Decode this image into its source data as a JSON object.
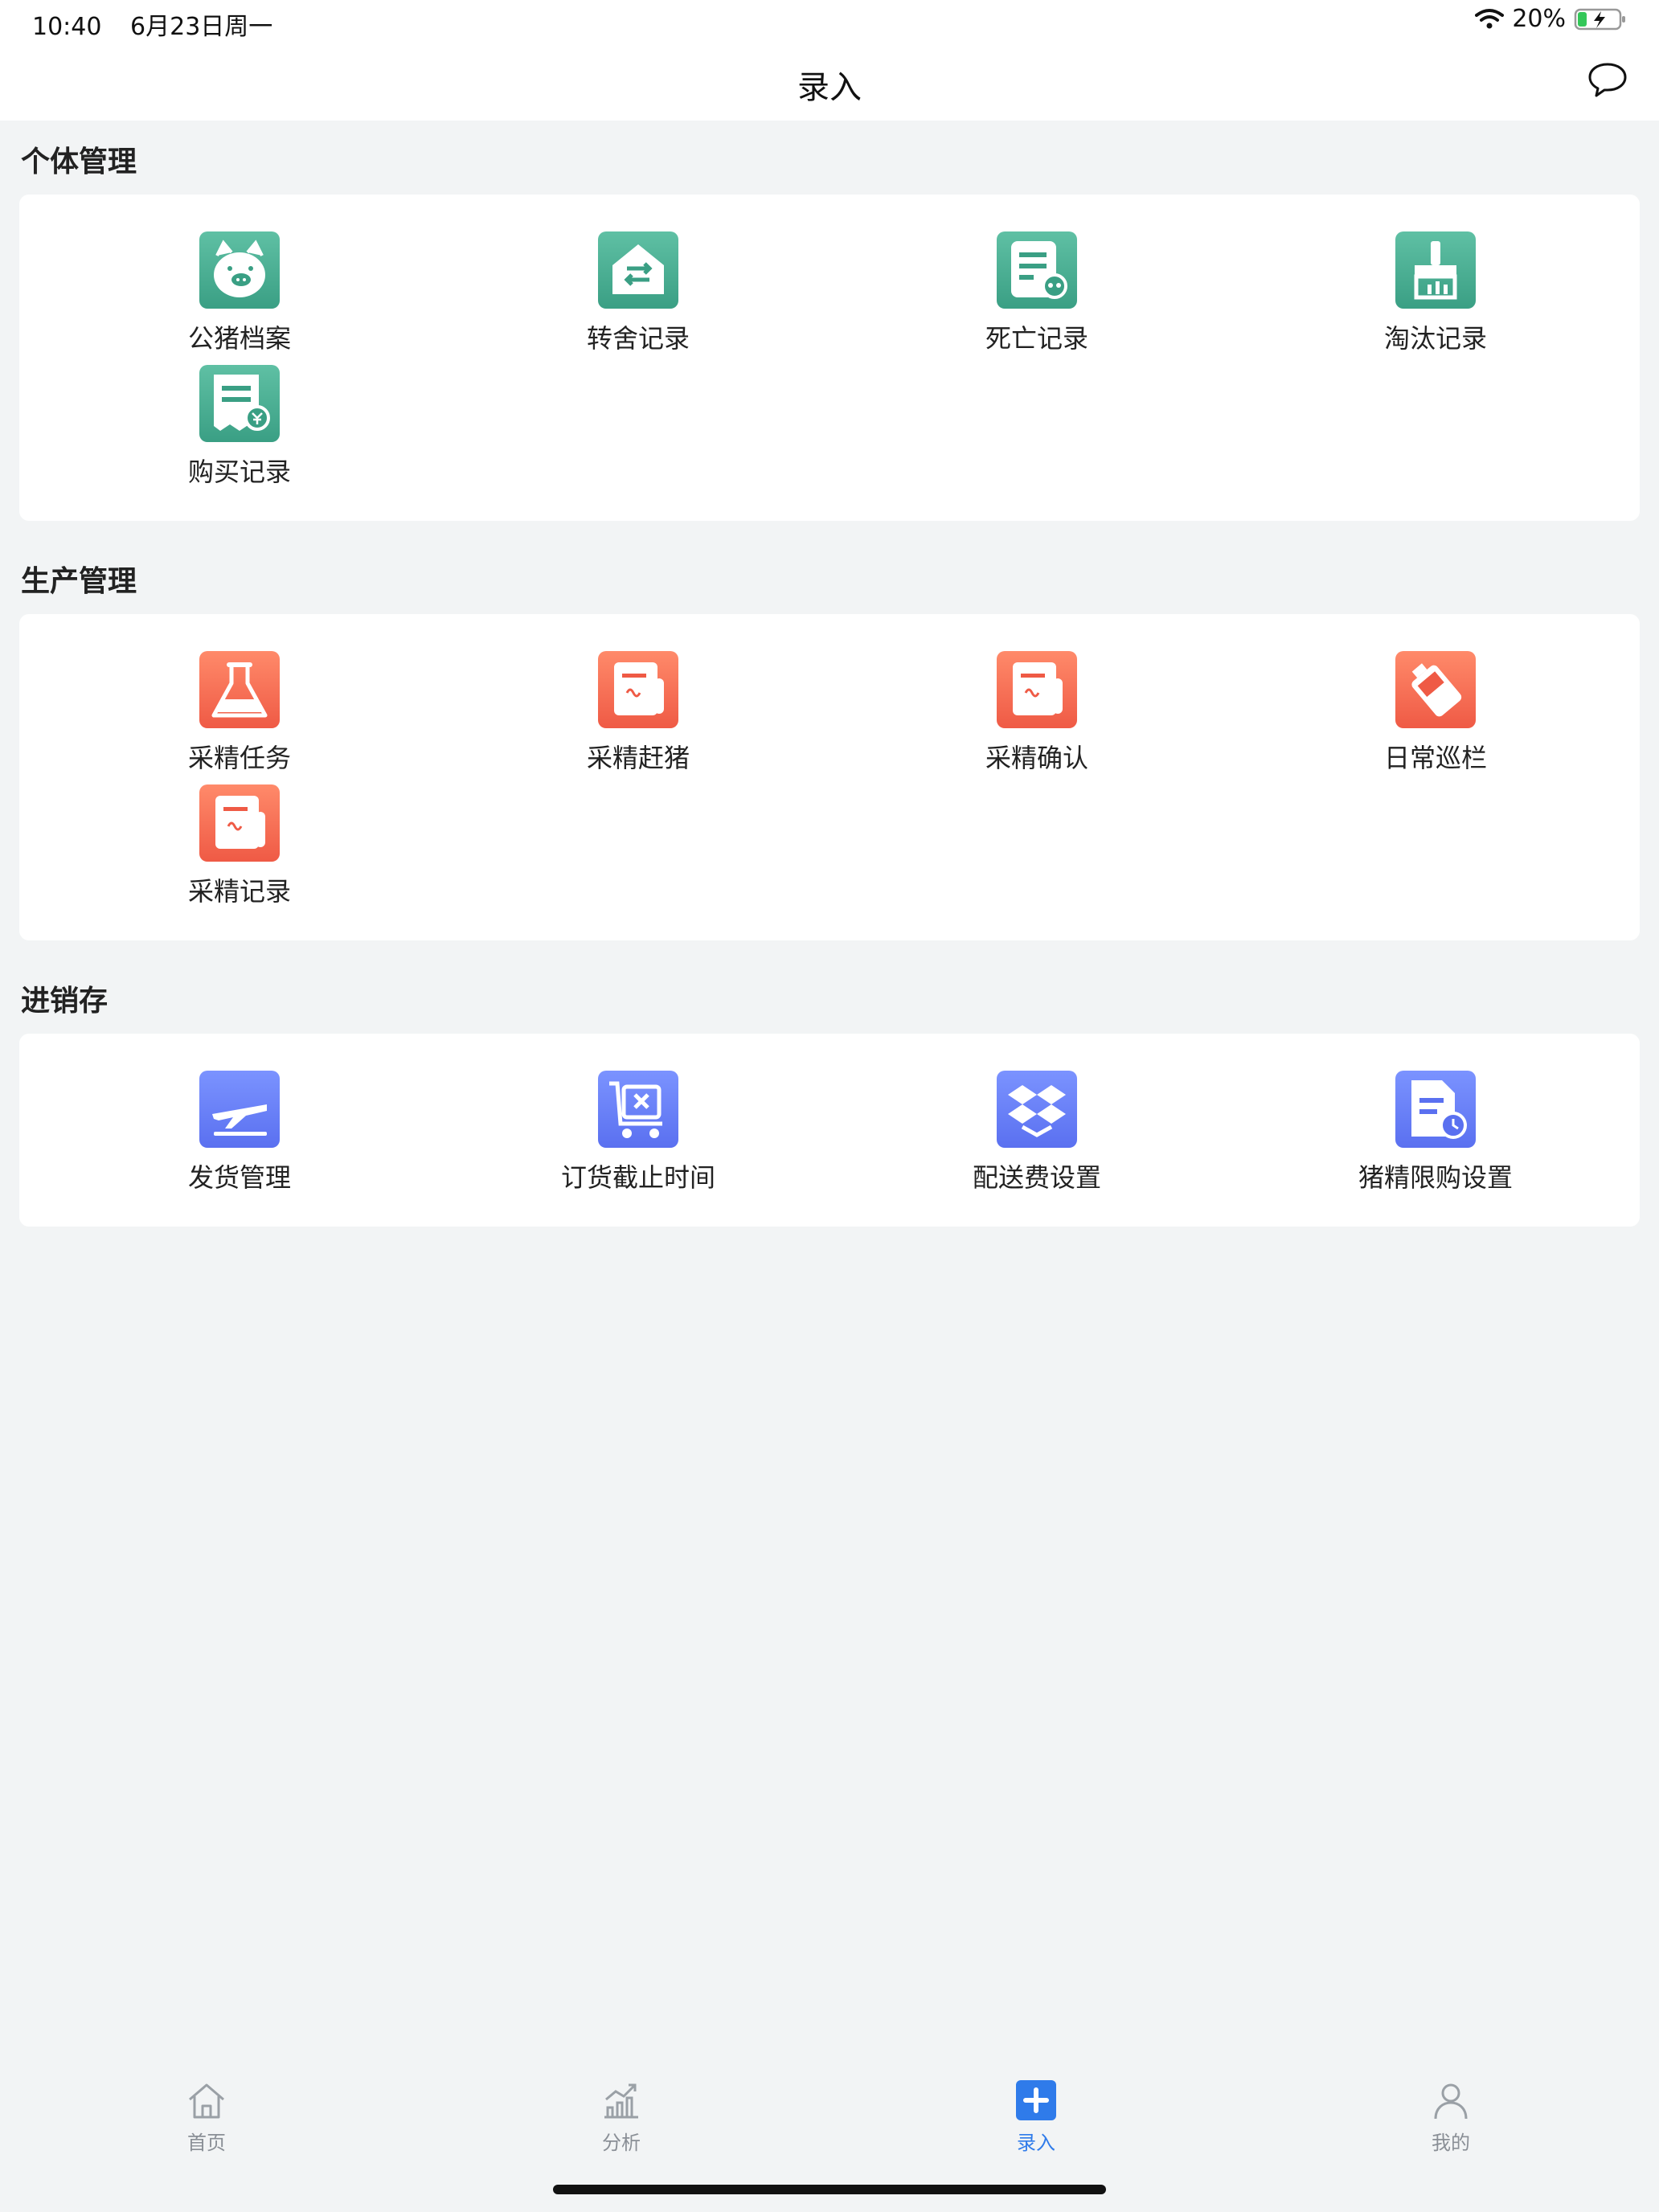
{
  "status_bar": {
    "time": "10:40",
    "date": "6月23日周一",
    "battery": "20%"
  },
  "nav": {
    "title": "录入"
  },
  "sections": [
    {
      "title": "个体管理",
      "items": [
        "公猪档案",
        "转舍记录",
        "死亡记录",
        "淘汰记录",
        "购买记录"
      ]
    },
    {
      "title": "生产管理",
      "items": [
        "采精任务",
        "采精赶猪",
        "采精确认",
        "日常巡栏",
        "采精记录"
      ]
    },
    {
      "title": "进销存",
      "items": [
        "发货管理",
        "订货截止时间",
        "配送费设置",
        "猪精限购设置"
      ]
    }
  ],
  "icons": {
    "section_0": [
      "pig-icon",
      "house-transfer-icon",
      "death-record-icon",
      "broom-icon",
      "purchase-receipt-icon"
    ],
    "section_1": [
      "flask-icon",
      "document-icon",
      "document-icon",
      "pda-icon",
      "document-icon"
    ],
    "section_2": [
      "airplane-icon",
      "cart-icon",
      "dropbox-icon",
      "file-clock-icon"
    ]
  },
  "colors": {
    "green": "#3a9f84",
    "orange": "#ef5a45",
    "blue": "#5a70f0",
    "tab_active": "#2f7bea"
  },
  "tabs": [
    {
      "label": "首页",
      "icon": "home-icon"
    },
    {
      "label": "分析",
      "icon": "chart-icon"
    },
    {
      "label": "录入",
      "icon": "plus-icon",
      "active": true
    },
    {
      "label": "我的",
      "icon": "user-icon"
    }
  ]
}
